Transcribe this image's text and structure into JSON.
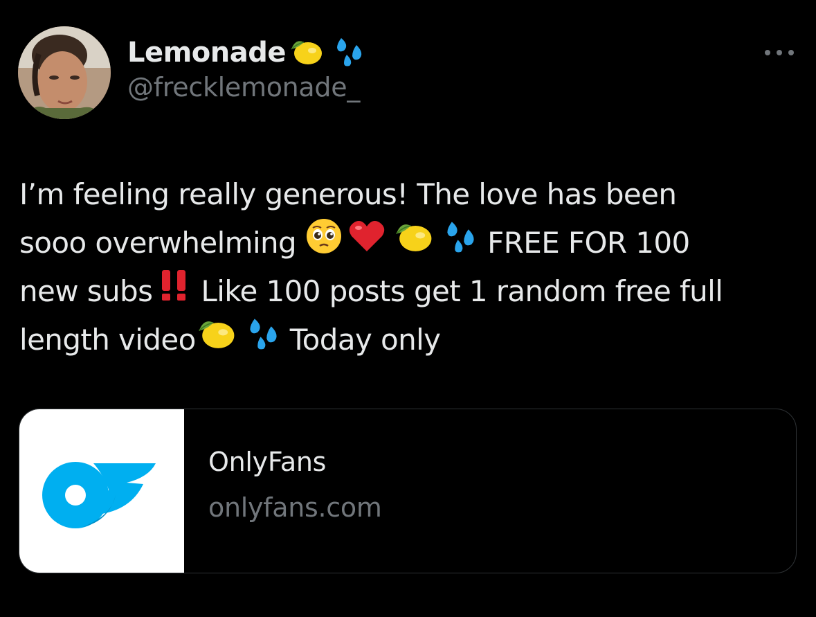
{
  "author": {
    "display_name": "Lemonade",
    "handle": "@frecklemonade_"
  },
  "tweet": {
    "line1": "I’m feeling really generous! The love has been",
    "line2_a": "sooo overwhelming",
    "line2_b": "FREE FOR 100",
    "line3_a": "new subs",
    "line3_b": "Like 100 posts get 1 random free full",
    "line4_a": "length video",
    "line4_b": "Today only"
  },
  "card": {
    "title": "OnlyFans",
    "domain": "onlyfans.com"
  },
  "icons": {
    "more": "more-horizontal-icon",
    "lemon": "lemon-emoji",
    "droplets": "sweat-droplets-emoji",
    "pleading": "pleading-face-emoji",
    "heart": "red-heart-emoji",
    "exclamation": "double-exclamation-emoji",
    "logo": "onlyfans-logo"
  },
  "colors": {
    "background": "#000000",
    "text": "#e7e9ea",
    "secondary": "#71767b",
    "border": "#2f3336",
    "brand": "#00aff0"
  }
}
